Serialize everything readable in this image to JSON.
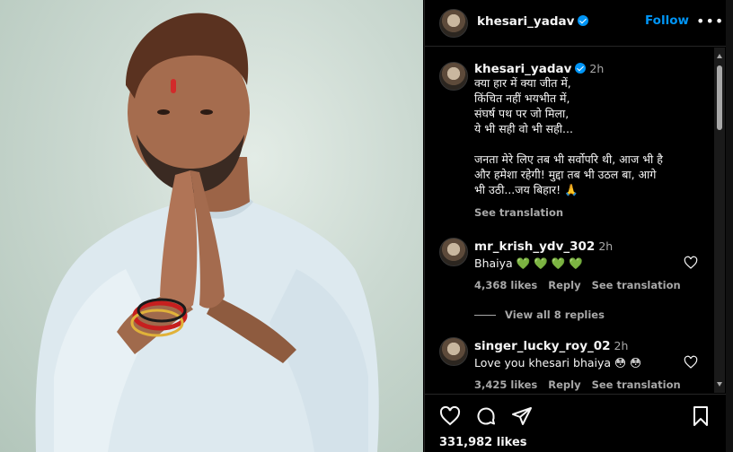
{
  "post": {
    "username": "khesari_yadav",
    "follow_label": "Follow",
    "more_label": "•••",
    "likes_count": "331,982",
    "likes_suffix": "likes"
  },
  "caption": {
    "username": "khesari_yadav",
    "time": "2h",
    "lines": [
      "क्या हार में क्या जीत में,",
      "किंचित नहीं भयभीत में,",
      "संघर्ष पथ पर जो मिला,",
      "ये भी सही वो भी सही..."
    ],
    "paragraph2": [
      "जनता मेरे लिए तब भी सर्वोपरि थी, आज भी है",
      "और हमेशा रहेगी! मुद्दा तब भी उठल बा, आगे",
      "भी उठी...जय बिहार! 🙏"
    ],
    "see_translation": "See translation"
  },
  "comments": [
    {
      "username": "mr_krish_ydv_302",
      "time": "2h",
      "text": "Bhaiya 💚 💚 💚 💚",
      "likes": "4,368 likes",
      "reply": "Reply",
      "see_translation": "See translation",
      "view_replies": "View all 8 replies"
    },
    {
      "username": "singer_lucky_roy_02",
      "time": "2h",
      "text": "Love you khesari bhaiya 😳 😳",
      "likes": "3,425 likes",
      "reply": "Reply",
      "see_translation": "See translation"
    }
  ],
  "icons": {
    "heart": "heart-icon",
    "comment": "comment-icon",
    "share": "share-icon",
    "save": "bookmark-icon",
    "verified": "verified-badge-icon"
  },
  "colors": {
    "accent": "#0095f6",
    "muted": "#a8a8a8",
    "background": "#000000"
  }
}
